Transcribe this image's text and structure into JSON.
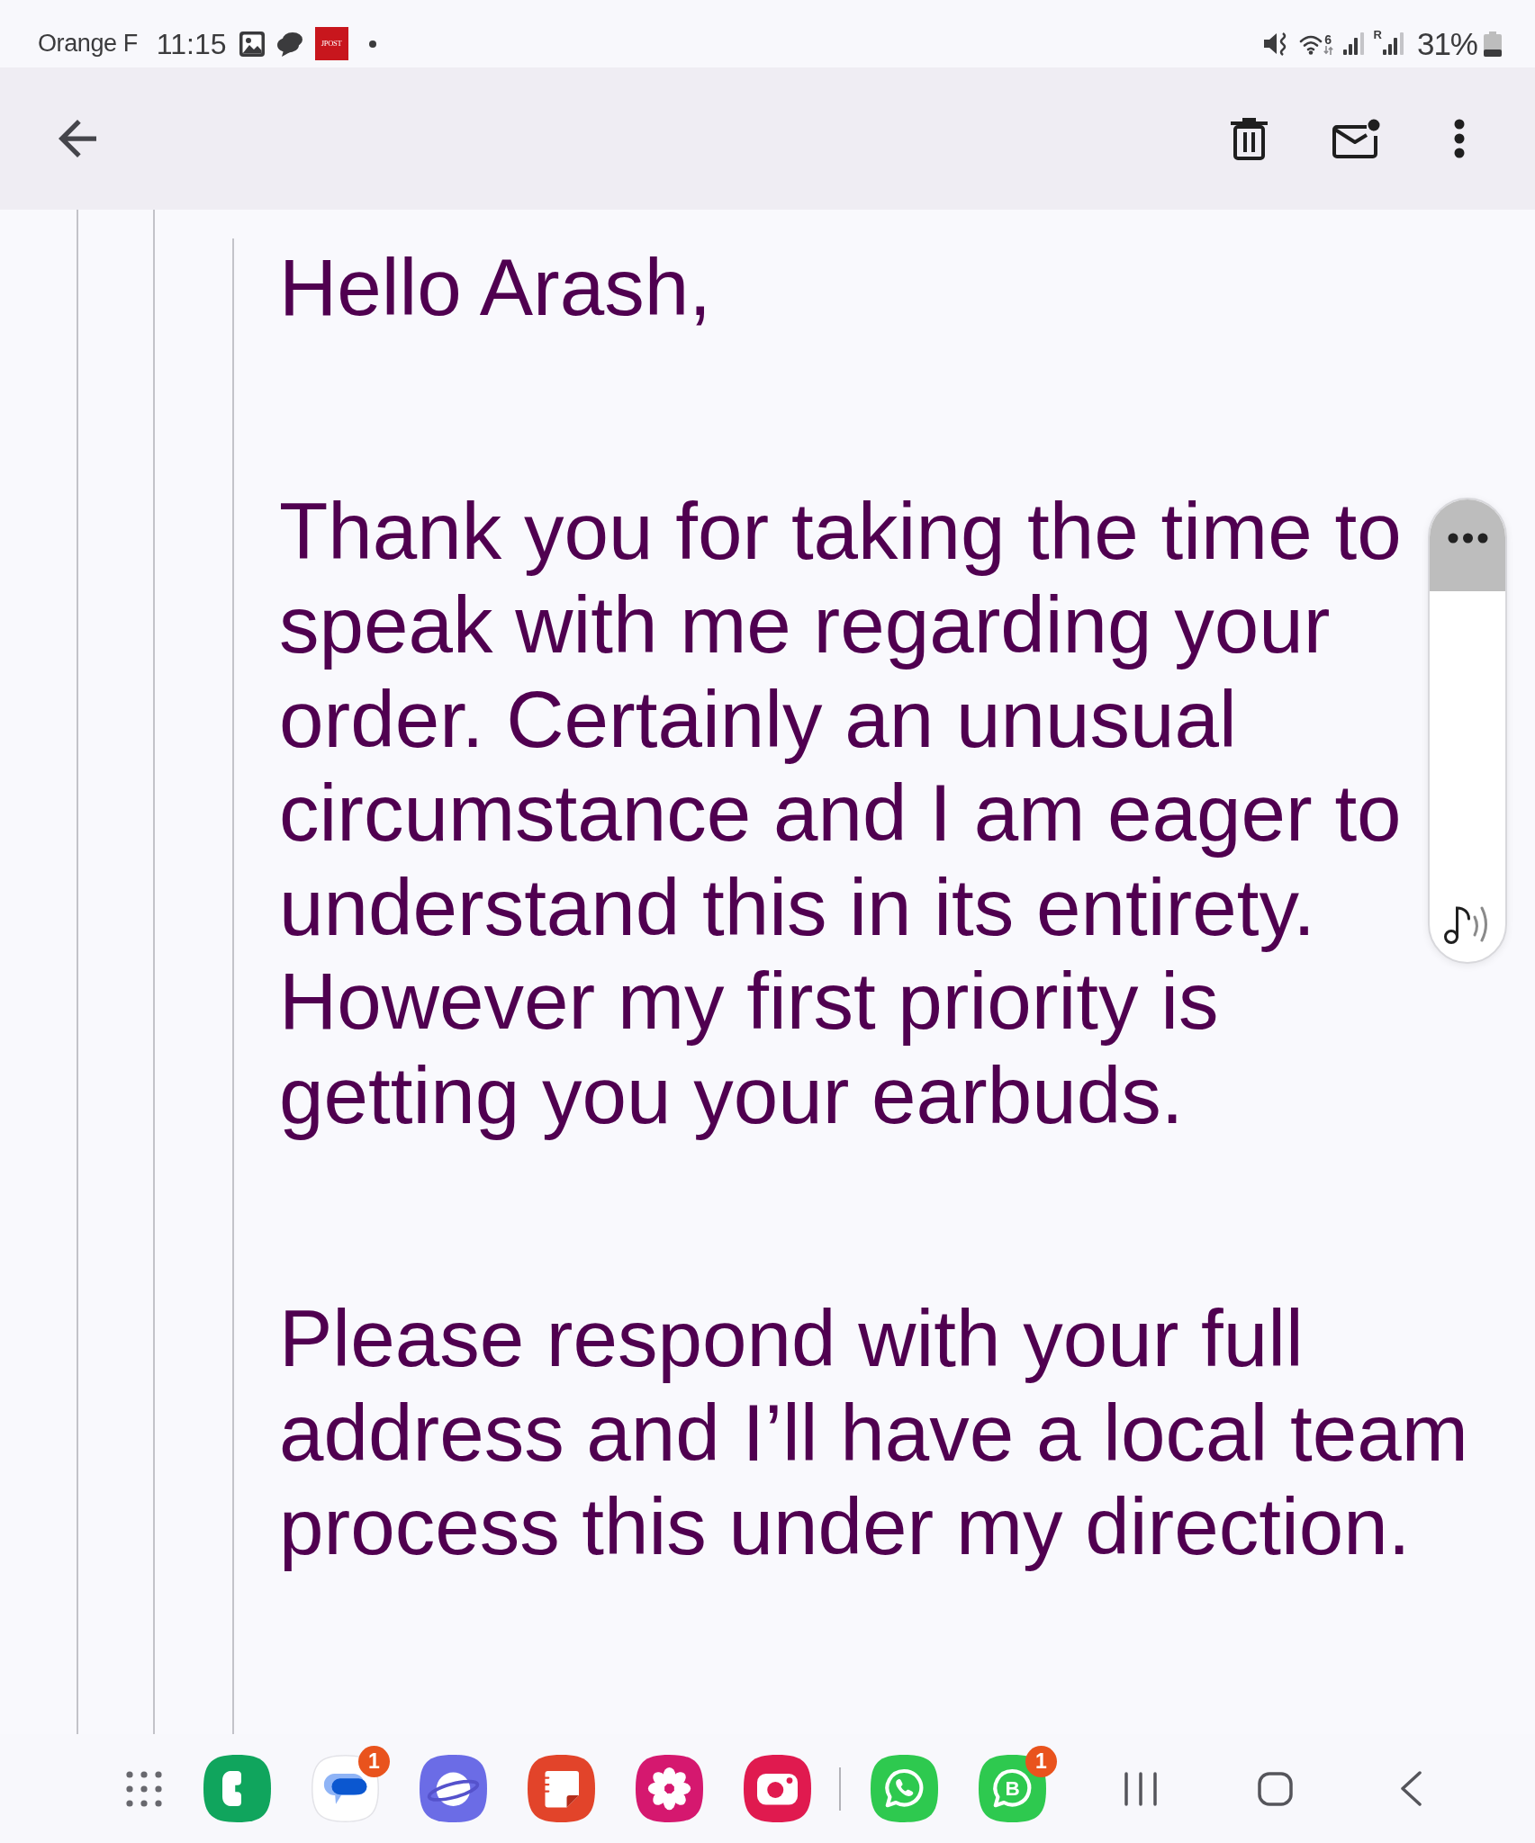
{
  "status_bar": {
    "carrier": "Orange F",
    "time": "11:15",
    "notifications": [
      {
        "kind": "image"
      },
      {
        "kind": "chat"
      },
      {
        "kind": "app",
        "label": "JPOST"
      },
      {
        "kind": "more"
      }
    ],
    "indicators": [
      {
        "kind": "mute"
      },
      {
        "kind": "wifi",
        "badge": "6"
      },
      {
        "kind": "signal"
      },
      {
        "kind": "signal",
        "badge": "R"
      }
    ],
    "battery": "31%"
  },
  "message": {
    "paragraphs": [
      {
        "lines": [
          "Hello Arash,"
        ]
      },
      {
        "lines": [
          "Thank you for taking the time to",
          "speak with me regarding your",
          "order. Certainly an unusual",
          "circumstance and I am eager to",
          "understand this in its entirety.",
          "However my first priority is",
          "getting you your earbuds."
        ]
      },
      {
        "lines": [
          "Please respond with your full",
          "address and I’ll have a local team",
          "process this under my direction."
        ]
      }
    ]
  },
  "dock": {
    "pinned_apps": [
      {
        "kind": "phone"
      },
      {
        "kind": "messages",
        "badge": "1"
      },
      {
        "kind": "internet"
      },
      {
        "kind": "notes"
      },
      {
        "kind": "gallery"
      },
      {
        "kind": "camera"
      }
    ],
    "recent_apps": [
      {
        "kind": "whatsapp"
      },
      {
        "kind": "whatsapp_business",
        "label": "B",
        "badge": "1"
      }
    ]
  }
}
